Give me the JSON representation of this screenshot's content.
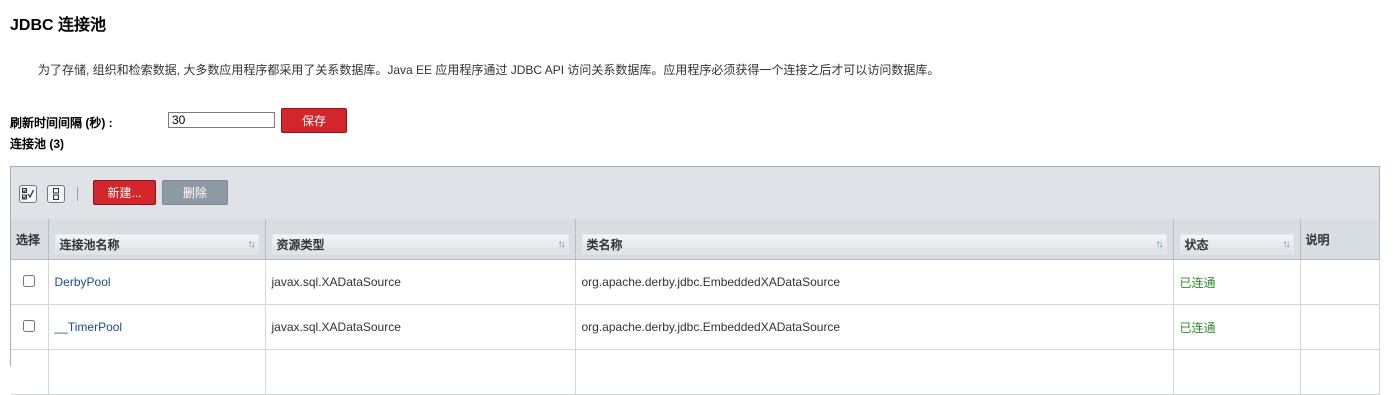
{
  "page": {
    "title": "JDBC 连接池",
    "description": "为了存储, 组织和检索数据, 大多数应用程序都采用了关系数据库。Java EE 应用程序通过 JDBC API 访问关系数据库。应用程序必须获得一个连接之后才可以访问数据库。"
  },
  "refresh": {
    "label": "刷新时间间隔 (秒) :",
    "value": "30",
    "save_label": "保存"
  },
  "pools": {
    "count_label": "连接池 (3)",
    "toolbar": {
      "select_all_icon": "select-all-icon",
      "deselect_all_icon": "deselect-all-icon",
      "new_label": "新建...",
      "delete_label": "删除"
    },
    "columns": {
      "select": "选择",
      "name": "连接池名称",
      "resource_type": "资源类型",
      "class_name": "类名称",
      "status": "状态",
      "description": "说明"
    },
    "rows": [
      {
        "name": "DerbyPool",
        "resource_type": "javax.sql.XADataSource",
        "class_name": "org.apache.derby.jdbc.EmbeddedXADataSource",
        "status": "已连通",
        "description": ""
      },
      {
        "name": "__TimerPool",
        "resource_type": "javax.sql.XADataSource",
        "class_name": "org.apache.derby.jdbc.EmbeddedXADataSource",
        "status": "已连通",
        "description": ""
      }
    ]
  },
  "colors": {
    "primary_button": "#d3252c",
    "disabled_button": "#8d9aa3",
    "link": "#1a4b8c",
    "status_ok": "#2e8b2e"
  }
}
